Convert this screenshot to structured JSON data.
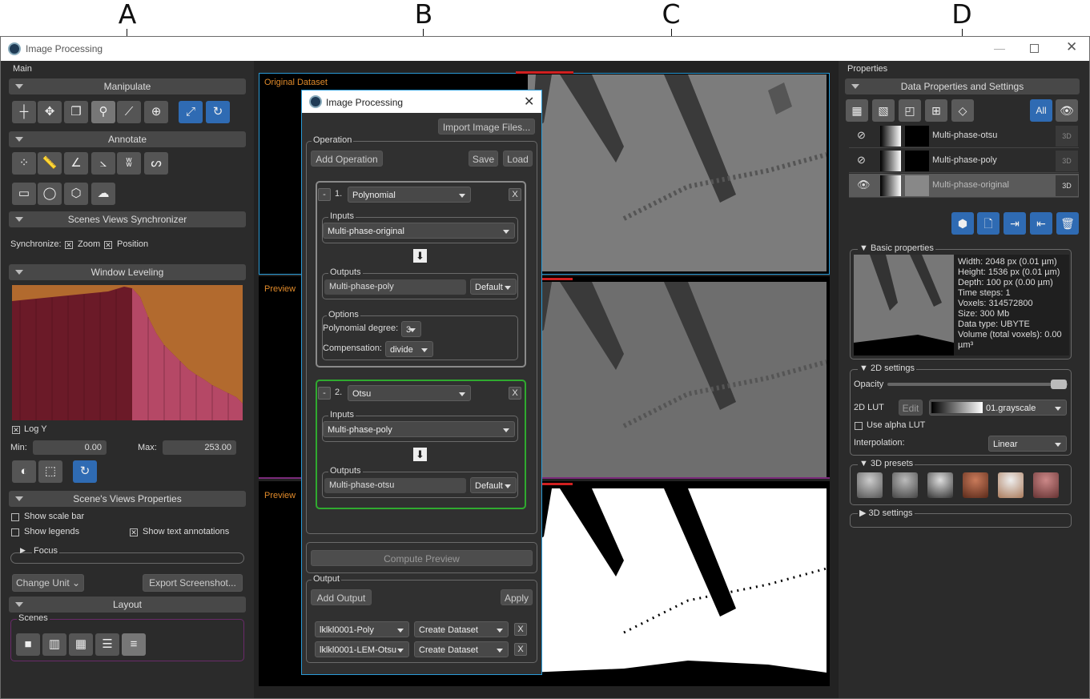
{
  "annotations": {
    "a": "A",
    "b": "B",
    "c": "C",
    "d": "D"
  },
  "window": {
    "title": "Image Processing"
  },
  "left": {
    "panel_title": "Main",
    "manipulate": "Manipulate",
    "annotate": "Annotate",
    "sync_section": "Scenes Views Synchronizer",
    "sync_label": "Synchronize:",
    "sync_zoom": "Zoom",
    "sync_position": "Position",
    "window_leveling": "Window Leveling",
    "log_y": "Log Y",
    "min_label": "Min:",
    "min_value": "0.00",
    "max_label": "Max:",
    "max_value": "253.00",
    "views_props": "Scene's Views Properties",
    "show_scale_bar": "Show scale bar",
    "show_legends": "Show legends",
    "show_text_annotations": "Show text annotations",
    "focus": "Focus",
    "change_unit": "Change Unit",
    "export_screenshot": "Export Screenshot...",
    "layout": "Layout",
    "scenes": "Scenes"
  },
  "center": {
    "original_label": "Original Dataset",
    "preview1_label": "Preview",
    "preview2_label": "Preview"
  },
  "dialog": {
    "title": "Image Processing",
    "import": "Import Image Files...",
    "operation": "Operation",
    "add_operation": "Add Operation",
    "save": "Save",
    "load": "Load",
    "op1": {
      "minus": "-",
      "index": "1.",
      "name": "Polynomial",
      "close": "X",
      "inputs": "Inputs",
      "input_value": "Multi-phase-original",
      "outputs": "Outputs",
      "output_value": "Multi-phase-poly",
      "output_mode": "Default",
      "options": "Options",
      "degree_label": "Polynomial degree:",
      "degree_value": "3",
      "comp_label": "Compensation:",
      "comp_value": "divide"
    },
    "op2": {
      "minus": "-",
      "index": "2.",
      "name": "Otsu",
      "close": "X",
      "inputs": "Inputs",
      "input_value": "Multi-phase-poly",
      "outputs": "Outputs",
      "output_value": "Multi-phase-otsu",
      "output_mode": "Default"
    },
    "compute_preview": "Compute Preview",
    "output": "Output",
    "add_output": "Add Output",
    "apply": "Apply",
    "outputs": [
      {
        "name": "lklkl0001-Poly",
        "action": "Create Dataset",
        "close": "X"
      },
      {
        "name": "lklkl0001-LEM-Otsu",
        "action": "Create Dataset",
        "close": "X"
      }
    ]
  },
  "right": {
    "panel_title": "Properties",
    "section": "Data Properties and Settings",
    "all_label": "All",
    "layers": [
      {
        "name": "Multi-phase-otsu",
        "badge": "3D"
      },
      {
        "name": "Multi-phase-poly",
        "badge": "3D"
      },
      {
        "name": "Multi-phase-original",
        "badge": "3D"
      }
    ],
    "basic_props": "Basic properties",
    "props": {
      "width": "Width: 2048 px (0.01 µm)",
      "height": "Height: 1536 px (0.01 µm)",
      "depth": "Depth: 100 px (0.00 µm)",
      "time": "Time steps: 1",
      "voxels": "Voxels: 314572800",
      "size": "Size: 300 Mb",
      "dtype": "Data type: UBYTE",
      "volume": "Volume (total voxels): 0.00 µm³"
    },
    "settings2d": "2D settings",
    "opacity": "Opacity",
    "lut_label": "2D LUT",
    "edit": "Edit",
    "lut_value": "01.grayscale",
    "use_alpha": "Use alpha LUT",
    "interp_label": "Interpolation:",
    "interp_value": "Linear",
    "presets3d": "3D presets",
    "settings3d": "3D settings"
  }
}
